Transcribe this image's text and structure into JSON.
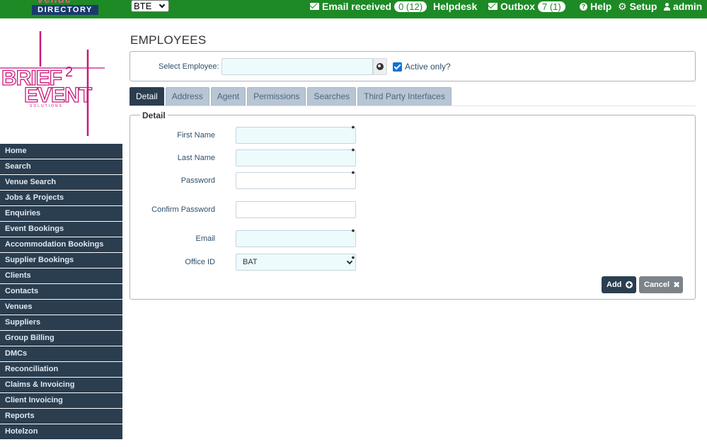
{
  "brand": {
    "top_logo_line1": "Venue",
    "top_logo_line2": "DIRECTORY",
    "side_logo_word1": "BRIEF",
    "side_logo_number": "2",
    "side_logo_word2": "EVENT",
    "side_logo_tagline": "SOLUTIONS"
  },
  "topbar": {
    "company_select_value": "BTE",
    "email_received_label": "Email received",
    "email_received_badge": "0 (12)",
    "helpdesk_label": "Helpdesk",
    "outbox_label": "Outbox",
    "outbox_badge": "7 (1)",
    "help_label": "Help",
    "setup_label": "Setup",
    "user_label": "admin",
    "bar_color": "#1d8a26"
  },
  "sidebar": {
    "items": [
      {
        "label": "Home"
      },
      {
        "label": "Search"
      },
      {
        "label": "Venue Search"
      },
      {
        "label": "Jobs & Projects"
      },
      {
        "label": "Enquiries"
      },
      {
        "label": "Event Bookings"
      },
      {
        "label": "Accommodation Bookings"
      },
      {
        "label": "Supplier Bookings"
      },
      {
        "label": "Clients"
      },
      {
        "label": "Contacts"
      },
      {
        "label": "Venues"
      },
      {
        "label": "Suppliers"
      },
      {
        "label": "Group Billing"
      },
      {
        "label": "DMCs"
      },
      {
        "label": "Reconciliation"
      },
      {
        "label": "Claims & Invoicing"
      },
      {
        "label": "Client Invoicing"
      },
      {
        "label": "Reports"
      },
      {
        "label": "Hotelzon"
      }
    ]
  },
  "main": {
    "page_title": "EMPLOYEES",
    "select_employee_label": "Select Employee:",
    "active_only_label": "Active only?",
    "active_only_checked": true,
    "tabs": [
      {
        "label": "Detail",
        "active": true
      },
      {
        "label": "Address"
      },
      {
        "label": "Agent"
      },
      {
        "label": "Permissions"
      },
      {
        "label": "Searches"
      },
      {
        "label": "Third Party Interfaces"
      }
    ],
    "detail": {
      "legend": "Detail",
      "first_name_label": "First Name",
      "last_name_label": "Last Name",
      "password_label": "Password",
      "confirm_password_label": "Confirm Password",
      "email_label": "Email",
      "office_id_label": "Office ID",
      "office_id_value": "BAT",
      "required_marker": "*",
      "add_label": "Add",
      "cancel_label": "Cancel"
    }
  }
}
